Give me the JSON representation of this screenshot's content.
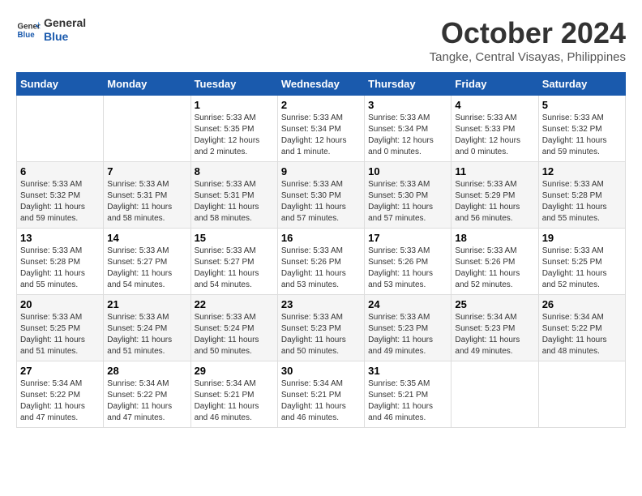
{
  "header": {
    "logo_line1": "General",
    "logo_line2": "Blue",
    "month": "October 2024",
    "location": "Tangke, Central Visayas, Philippines"
  },
  "days_of_week": [
    "Sunday",
    "Monday",
    "Tuesday",
    "Wednesday",
    "Thursday",
    "Friday",
    "Saturday"
  ],
  "weeks": [
    [
      {
        "day": "",
        "info": ""
      },
      {
        "day": "",
        "info": ""
      },
      {
        "day": "1",
        "info": "Sunrise: 5:33 AM\nSunset: 5:35 PM\nDaylight: 12 hours\nand 2 minutes."
      },
      {
        "day": "2",
        "info": "Sunrise: 5:33 AM\nSunset: 5:34 PM\nDaylight: 12 hours\nand 1 minute."
      },
      {
        "day": "3",
        "info": "Sunrise: 5:33 AM\nSunset: 5:34 PM\nDaylight: 12 hours\nand 0 minutes."
      },
      {
        "day": "4",
        "info": "Sunrise: 5:33 AM\nSunset: 5:33 PM\nDaylight: 12 hours\nand 0 minutes."
      },
      {
        "day": "5",
        "info": "Sunrise: 5:33 AM\nSunset: 5:32 PM\nDaylight: 11 hours\nand 59 minutes."
      }
    ],
    [
      {
        "day": "6",
        "info": "Sunrise: 5:33 AM\nSunset: 5:32 PM\nDaylight: 11 hours\nand 59 minutes."
      },
      {
        "day": "7",
        "info": "Sunrise: 5:33 AM\nSunset: 5:31 PM\nDaylight: 11 hours\nand 58 minutes."
      },
      {
        "day": "8",
        "info": "Sunrise: 5:33 AM\nSunset: 5:31 PM\nDaylight: 11 hours\nand 58 minutes."
      },
      {
        "day": "9",
        "info": "Sunrise: 5:33 AM\nSunset: 5:30 PM\nDaylight: 11 hours\nand 57 minutes."
      },
      {
        "day": "10",
        "info": "Sunrise: 5:33 AM\nSunset: 5:30 PM\nDaylight: 11 hours\nand 57 minutes."
      },
      {
        "day": "11",
        "info": "Sunrise: 5:33 AM\nSunset: 5:29 PM\nDaylight: 11 hours\nand 56 minutes."
      },
      {
        "day": "12",
        "info": "Sunrise: 5:33 AM\nSunset: 5:28 PM\nDaylight: 11 hours\nand 55 minutes."
      }
    ],
    [
      {
        "day": "13",
        "info": "Sunrise: 5:33 AM\nSunset: 5:28 PM\nDaylight: 11 hours\nand 55 minutes."
      },
      {
        "day": "14",
        "info": "Sunrise: 5:33 AM\nSunset: 5:27 PM\nDaylight: 11 hours\nand 54 minutes."
      },
      {
        "day": "15",
        "info": "Sunrise: 5:33 AM\nSunset: 5:27 PM\nDaylight: 11 hours\nand 54 minutes."
      },
      {
        "day": "16",
        "info": "Sunrise: 5:33 AM\nSunset: 5:26 PM\nDaylight: 11 hours\nand 53 minutes."
      },
      {
        "day": "17",
        "info": "Sunrise: 5:33 AM\nSunset: 5:26 PM\nDaylight: 11 hours\nand 53 minutes."
      },
      {
        "day": "18",
        "info": "Sunrise: 5:33 AM\nSunset: 5:26 PM\nDaylight: 11 hours\nand 52 minutes."
      },
      {
        "day": "19",
        "info": "Sunrise: 5:33 AM\nSunset: 5:25 PM\nDaylight: 11 hours\nand 52 minutes."
      }
    ],
    [
      {
        "day": "20",
        "info": "Sunrise: 5:33 AM\nSunset: 5:25 PM\nDaylight: 11 hours\nand 51 minutes."
      },
      {
        "day": "21",
        "info": "Sunrise: 5:33 AM\nSunset: 5:24 PM\nDaylight: 11 hours\nand 51 minutes."
      },
      {
        "day": "22",
        "info": "Sunrise: 5:33 AM\nSunset: 5:24 PM\nDaylight: 11 hours\nand 50 minutes."
      },
      {
        "day": "23",
        "info": "Sunrise: 5:33 AM\nSunset: 5:23 PM\nDaylight: 11 hours\nand 50 minutes."
      },
      {
        "day": "24",
        "info": "Sunrise: 5:33 AM\nSunset: 5:23 PM\nDaylight: 11 hours\nand 49 minutes."
      },
      {
        "day": "25",
        "info": "Sunrise: 5:34 AM\nSunset: 5:23 PM\nDaylight: 11 hours\nand 49 minutes."
      },
      {
        "day": "26",
        "info": "Sunrise: 5:34 AM\nSunset: 5:22 PM\nDaylight: 11 hours\nand 48 minutes."
      }
    ],
    [
      {
        "day": "27",
        "info": "Sunrise: 5:34 AM\nSunset: 5:22 PM\nDaylight: 11 hours\nand 47 minutes."
      },
      {
        "day": "28",
        "info": "Sunrise: 5:34 AM\nSunset: 5:22 PM\nDaylight: 11 hours\nand 47 minutes."
      },
      {
        "day": "29",
        "info": "Sunrise: 5:34 AM\nSunset: 5:21 PM\nDaylight: 11 hours\nand 46 minutes."
      },
      {
        "day": "30",
        "info": "Sunrise: 5:34 AM\nSunset: 5:21 PM\nDaylight: 11 hours\nand 46 minutes."
      },
      {
        "day": "31",
        "info": "Sunrise: 5:35 AM\nSunset: 5:21 PM\nDaylight: 11 hours\nand 46 minutes."
      },
      {
        "day": "",
        "info": ""
      },
      {
        "day": "",
        "info": ""
      }
    ]
  ]
}
